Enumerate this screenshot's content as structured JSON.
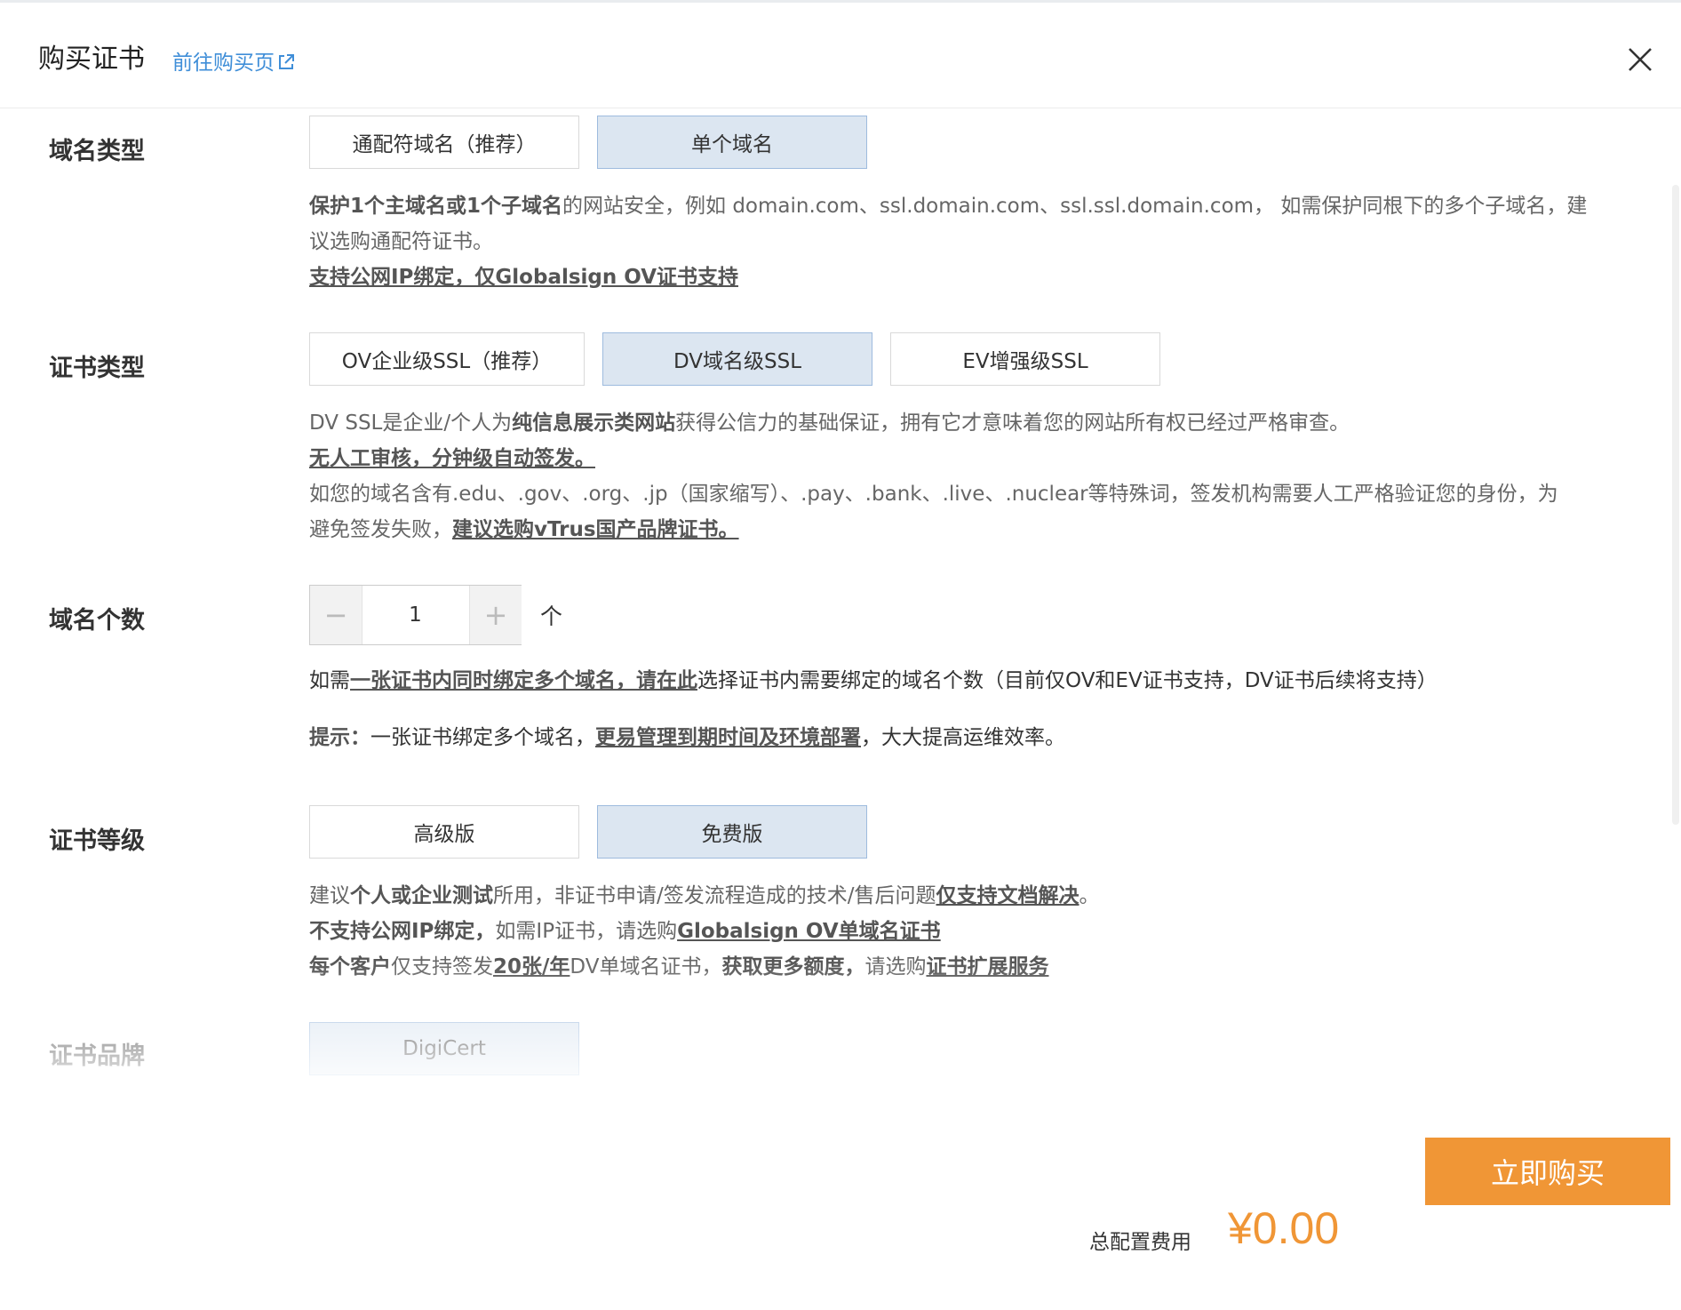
{
  "header": {
    "title": "购买证书",
    "link": "前往购买页"
  },
  "sections": {
    "domain_type": {
      "label": "域名类型",
      "options": [
        "通配符域名（推荐）",
        "单个域名"
      ],
      "selected": "单个域名",
      "desc": {
        "l1_b1": "保护1个主域名或1个子域名",
        "l1_t1": "的网站安全，例如 domain.com、ssl.domain.com、ssl.ssl.domain.com， 如需保护同根下的多个子域名，建",
        "l2": "议选购通配符证书。",
        "l3_u": "支持公网IP绑定，仅Globalsign OV证书支持"
      }
    },
    "cert_type": {
      "label": "证书类型",
      "options": [
        "OV企业级SSL（推荐）",
        "DV域名级SSL",
        "EV增强级SSL"
      ],
      "selected": "DV域名级SSL",
      "desc": {
        "l1_t1": "DV SSL是企业/个人为",
        "l1_b1": "纯信息展示类网站",
        "l1_t2": "获得公信力的基础保证，拥有它才意味着您的网站所有权已经过严格审查。",
        "l2_u": "无人工审核，分钟级自动签发。",
        "l3": "如您的域名含有.edu、.gov、.org、.jp（国家缩写）、.pay、.bank、.live、.nuclear等特殊词，签发机构需要人工严格验证您的身份，为",
        "l4_t1": "避免签发失败，",
        "l4_u": "建议选购vTrus国产品牌证书。"
      }
    },
    "domain_count": {
      "label": "域名个数",
      "value": "1",
      "minus": "−",
      "plus": "+",
      "unit": "个",
      "desc": {
        "l1_t1": "如需",
        "l1_u": "一张证书内同时绑定多个域名，请在此",
        "l1_t2": "选择证书内需要绑定的域名个数（目前仅OV和EV证书支持，DV证书后续将支持）",
        "l2_b": "提示：",
        "l2_t1": "一张证书绑定多个域名，",
        "l2_u": "更易管理到期时间及环境部署",
        "l2_t2": "，大大提高运维效率。"
      }
    },
    "cert_level": {
      "label": "证书等级",
      "options": [
        "高级版",
        "免费版"
      ],
      "selected": "免费版",
      "desc": {
        "l1_t1": "建议",
        "l1_b1": "个人或企业测试",
        "l1_t2": "所用，非证书申请/签发流程造成的技术/售后问题",
        "l1_u": "仅支持文档解决",
        "l1_t3": "。",
        "l2_b": "不支持公网IP绑定，",
        "l2_t1": "如需IP证书，请选购",
        "l2_u": "Globalsign OV单域名证书",
        "l3_b1": "每个客户",
        "l3_t1": "仅支持签发",
        "l3_u1": "20张/年",
        "l3_t2": "DV单域名证书，",
        "l3_b2": "获取更多额度，",
        "l3_t3": "请选购",
        "l3_u2": "证书扩展服务"
      }
    },
    "cert_brand": {
      "label": "证书品牌",
      "options": [
        "DigiCert"
      ],
      "selected": "DigiCert"
    }
  },
  "footer": {
    "buy_button": "立即购买",
    "total_label": "总配置费用",
    "total_value": "¥0.00"
  },
  "colors": {
    "accent": "#f09636",
    "link": "#3f8ed8",
    "selected_bg": "#dce6f1"
  }
}
